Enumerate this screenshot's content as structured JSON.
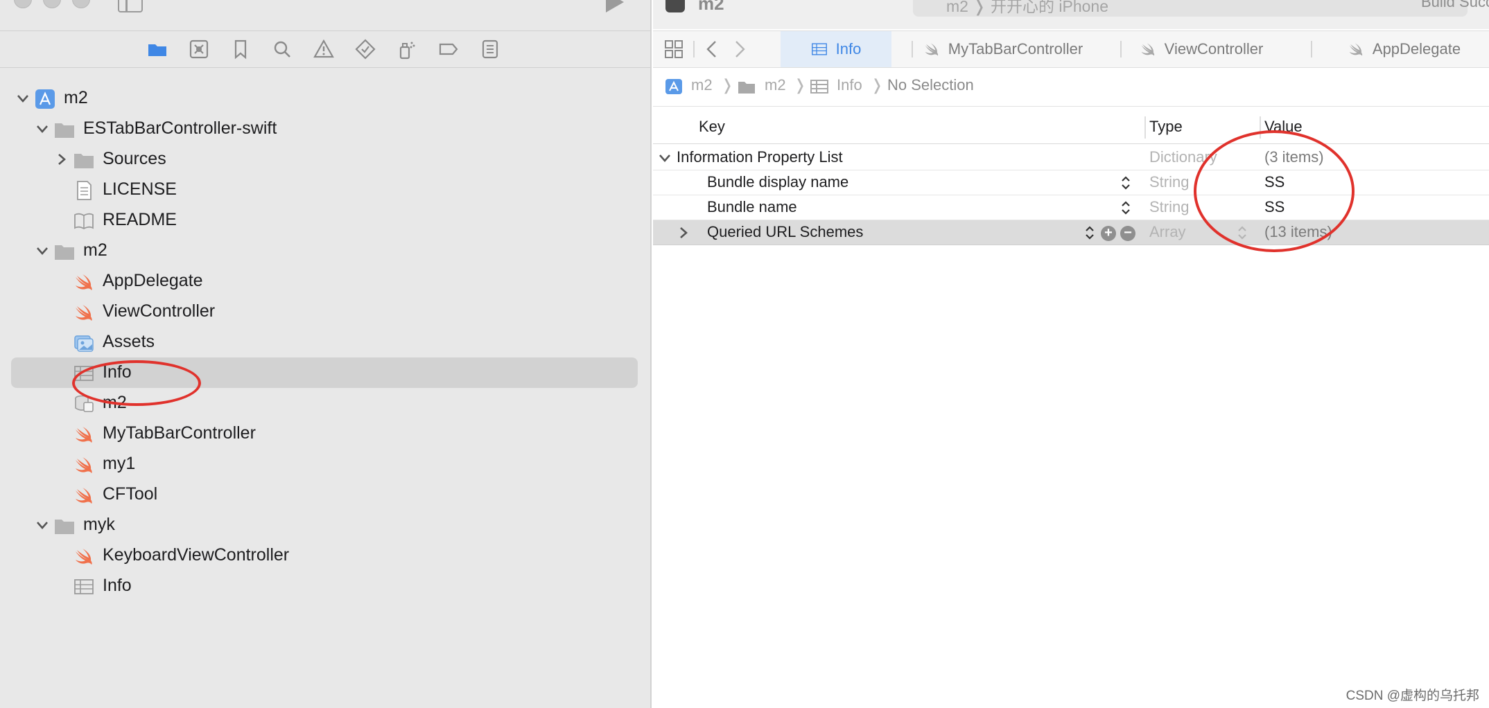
{
  "window": {
    "project_title": "m2",
    "scheme": "m2  ❭  开开心的 iPhone",
    "build_status": "Build Succeeded"
  },
  "navigator": {
    "toolbar_icons": [
      "folder-icon",
      "source-control-icon",
      "bookmark-icon",
      "search-icon",
      "warning-icon",
      "test-diamond-icon",
      "debug-spray-icon",
      "breakpoint-icon",
      "report-icon"
    ],
    "tree": [
      {
        "label": "m2",
        "icon": "xcode-project-icon",
        "depth": 0,
        "disclosure": "open"
      },
      {
        "label": "ESTabBarController-swift",
        "icon": "folder-icon",
        "depth": 1,
        "disclosure": "open"
      },
      {
        "label": "Sources",
        "icon": "folder-icon",
        "depth": 2,
        "disclosure": "closed"
      },
      {
        "label": "LICENSE",
        "icon": "text-file-icon",
        "depth": 2,
        "disclosure": "none"
      },
      {
        "label": "README",
        "icon": "book-icon",
        "depth": 2,
        "disclosure": "none"
      },
      {
        "label": "m2",
        "icon": "folder-icon",
        "depth": 1,
        "disclosure": "open"
      },
      {
        "label": "AppDelegate",
        "icon": "swift-icon",
        "depth": 2,
        "disclosure": "none"
      },
      {
        "label": "ViewController",
        "icon": "swift-icon",
        "depth": 2,
        "disclosure": "none"
      },
      {
        "label": "Assets",
        "icon": "asset-catalog-icon",
        "depth": 2,
        "disclosure": "none"
      },
      {
        "label": "Info",
        "icon": "plist-table-icon",
        "depth": 2,
        "disclosure": "none",
        "selected": true
      },
      {
        "label": "m2",
        "icon": "data-model-icon",
        "depth": 2,
        "disclosure": "none"
      },
      {
        "label": "MyTabBarController",
        "icon": "swift-icon",
        "depth": 2,
        "disclosure": "none"
      },
      {
        "label": "my1",
        "icon": "swift-icon",
        "depth": 2,
        "disclosure": "none"
      },
      {
        "label": "CFTool",
        "icon": "swift-icon",
        "depth": 2,
        "disclosure": "none"
      },
      {
        "label": "myk",
        "icon": "folder-icon",
        "depth": 1,
        "disclosure": "open"
      },
      {
        "label": "KeyboardViewController",
        "icon": "swift-icon",
        "depth": 2,
        "disclosure": "none"
      },
      {
        "label": "Info",
        "icon": "plist-table-icon",
        "depth": 2,
        "disclosure": "none"
      }
    ]
  },
  "editor": {
    "tabs": [
      {
        "label": "Info",
        "icon": "plist-table-icon",
        "active": true
      },
      {
        "label": "MyTabBarController",
        "icon": "swift-icon",
        "active": false
      },
      {
        "label": "ViewController",
        "icon": "swift-icon",
        "active": false
      },
      {
        "label": "AppDelegate",
        "icon": "swift-icon",
        "active": false
      }
    ],
    "jump_bar": [
      "m2",
      "m2",
      "Info",
      "No Selection"
    ],
    "columns": {
      "key": "Key",
      "type": "Type",
      "value": "Value"
    },
    "rows": [
      {
        "key": "Information Property List",
        "type": "Dictionary",
        "value": "(3 items)",
        "level": 0
      },
      {
        "key": "Bundle display name",
        "type": "String",
        "value": "SS",
        "level": 1
      },
      {
        "key": "Bundle name",
        "type": "String",
        "value": "SS",
        "level": 1
      },
      {
        "key": "Queried URL Schemes",
        "type": "Array",
        "value": "(13 items)",
        "level": 1,
        "selected": true
      }
    ]
  },
  "watermark": "CSDN @虚构的乌托邦",
  "colors": {
    "accent": "#3f87e5",
    "annotation_red": "#e0322c",
    "swift_orange": "#f0714c"
  }
}
